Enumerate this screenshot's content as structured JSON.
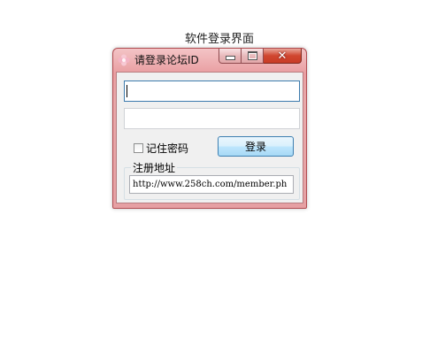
{
  "page": {
    "title": "软件登录界面"
  },
  "window": {
    "title": "请登录论坛ID",
    "icon": "app-flower-icon",
    "controls": {
      "minimize": "minimize-icon",
      "maximize": "maximize-icon",
      "close": "close-icon"
    }
  },
  "form": {
    "username_value": "",
    "password_value": "",
    "remember_label": "记住密码",
    "remember_checked": false,
    "login_label": "登录",
    "register_group_label": "注册地址",
    "register_url": "http://www.258ch.com/member.ph"
  },
  "colors": {
    "frame": "#e99ea1",
    "client_bg": "#f0f0f0",
    "close_button": "#d0462f",
    "focus_border": "#3d7bad"
  }
}
